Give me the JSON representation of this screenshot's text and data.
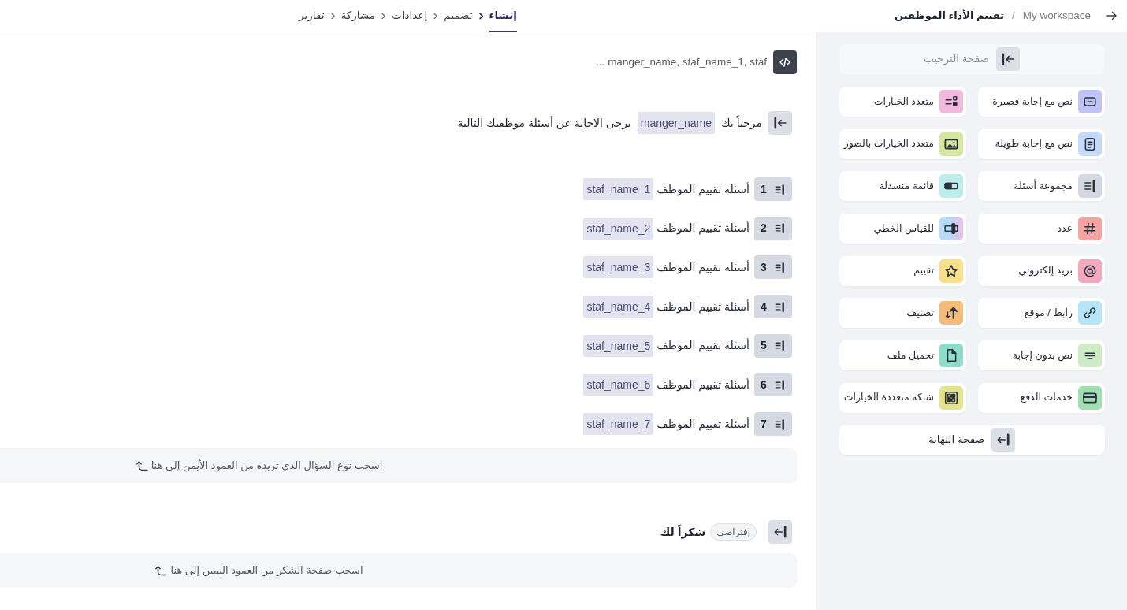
{
  "top_bar": {
    "breadcrumb": {
      "workspace": "My workspace",
      "separator": "/",
      "title": "تقييم الأداء الموظفين"
    },
    "steps": [
      {
        "label": "إنشاء",
        "selected": true
      },
      {
        "label": "تصميم",
        "selected": false
      },
      {
        "label": "إعدادات",
        "selected": false
      },
      {
        "label": "مشاركة",
        "selected": false
      },
      {
        "label": "تقارير",
        "selected": false
      }
    ]
  },
  "sidebar": {
    "welcome_page": {
      "label": "صفحة الترحيب",
      "disabled": true
    },
    "items": [
      {
        "label": "نص مع إجابة قصيرة",
        "kind": "short_text",
        "color": "#bfc3f5"
      },
      {
        "label": "متعدد الخيارات",
        "kind": "multiple_choice",
        "color": "#f2b9df"
      },
      {
        "label": "نص مع إجابة طويلة",
        "kind": "long_text",
        "color": "#c5d9f8"
      },
      {
        "label": "متعدد الخيارات بالصور",
        "kind": "image_choice",
        "color": "#d5e6a2"
      },
      {
        "label": "مجموعة أسئلة",
        "kind": "question_group",
        "color": "#d4d8e2"
      },
      {
        "label": "قائمة منسدلة",
        "kind": "dropdown",
        "color": "#bdeeed"
      },
      {
        "label": "عدد",
        "kind": "number",
        "color": "#f5a3a3"
      },
      {
        "label": "للقياس الخطي",
        "kind": "linear_scale",
        "color": "#b6dcf7"
      },
      {
        "label": "بريد إلكتروني",
        "kind": "email",
        "color": "#f2a8bd"
      },
      {
        "label": "تقييم",
        "kind": "rating",
        "color": "#f7df8c"
      },
      {
        "label": "رابط / موقع",
        "kind": "link",
        "color": "#b6e4f8"
      },
      {
        "label": "تصنيف",
        "kind": "ranking",
        "color": "#f5bb78"
      },
      {
        "label": "نص بدون إجابة",
        "kind": "statement",
        "color": "#cdebc4"
      },
      {
        "label": "تحميل ملف",
        "kind": "file_upload",
        "color": "#8edccb"
      },
      {
        "label": "خدمات الدفع",
        "kind": "payment",
        "color": "#9fe0b0"
      },
      {
        "label": "شبكة متعددة الخيارات",
        "kind": "grid_choice",
        "color": "#e3e48c"
      }
    ],
    "end_page": {
      "label": "صفحة النهاية",
      "disabled": false
    }
  },
  "main": {
    "variables_preview": "manger_name, staf_name_1, staf ...",
    "welcome": {
      "text_before": "مرحباً بك",
      "variable": "manger_name",
      "text_after": "يرجى الاجابة عن أسئلة موظفيك التالية"
    },
    "question_groups": [
      {
        "number": "1",
        "title": "أسئلة تقييم الموظف",
        "variable": "staf_name_1"
      },
      {
        "number": "2",
        "title": "أسئلة تقييم الموظف",
        "variable": "staf_name_2"
      },
      {
        "number": "3",
        "title": "أسئلة تقييم الموظف",
        "variable": "staf_name_3"
      },
      {
        "number": "4",
        "title": "أسئلة تقييم الموظف",
        "variable": "staf_name_4"
      },
      {
        "number": "5",
        "title": "أسئلة تقييم الموظف",
        "variable": "staf_name_5"
      },
      {
        "number": "6",
        "title": "أسئلة تقييم الموظف",
        "variable": "staf_name_6"
      },
      {
        "number": "7",
        "title": "أسئلة تقييم الموظف",
        "variable": "staf_name_7"
      }
    ],
    "questions_drop_hint": "اسحب نوع السؤال الذي تريده من العمود الأيمن إلى هنا",
    "ending": {
      "badge": "إفتراضي",
      "title": "شكراً لك"
    },
    "ending_drop_hint": "اسحب صفحة الشكر من العمود اليمين إلى هنا"
  }
}
